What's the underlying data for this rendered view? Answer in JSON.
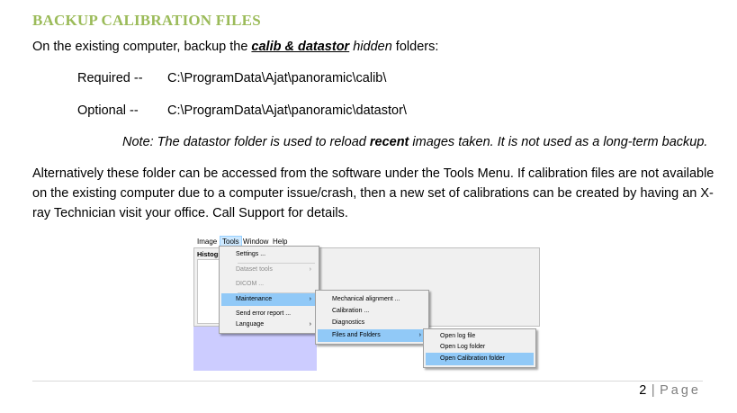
{
  "heading": "BACKUP CALIBRATION FILES",
  "intro": {
    "before": "On the existing computer, backup the ",
    "emph": "calib & datastor",
    "middle": " hidden",
    "after": " folders:"
  },
  "required": {
    "label": "Required --",
    "path": "C:\\ProgramData\\Ajat\\panoramic\\calib\\"
  },
  "optional": {
    "label": "Optional --",
    "path": "C:\\ProgramData\\Ajat\\panoramic\\datastor\\"
  },
  "note": {
    "before": "Note:  The datastor folder is used to reload ",
    "bold": "recent",
    "after": " images taken.  It is not used as a long-term backup."
  },
  "paragraph": [
    "Alternatively these folder can be accessed from the software under the Tools Menu.  If calibration files are not available",
    "on the existing computer due to a computer issue/crash, then a new set of calibrations can be created by having an X-",
    "ray Technician visit your office.  Call Support for details."
  ],
  "screenshot": {
    "menubar": [
      "Image",
      "Tools",
      "Window",
      "Help"
    ],
    "window_label": "Histogr",
    "tools_menu": [
      {
        "label": "Settings ...",
        "disabled": false,
        "submenu": false
      },
      {
        "label": "Dataset tools",
        "disabled": true,
        "submenu": true
      },
      {
        "label": "DICOM ...",
        "disabled": true,
        "submenu": false
      },
      {
        "label": "Maintenance",
        "disabled": false,
        "submenu": true,
        "highlighted": true
      },
      {
        "label": "Send error report ...",
        "disabled": false,
        "submenu": false
      },
      {
        "label": "Language",
        "disabled": false,
        "submenu": true
      }
    ],
    "maintenance_menu": [
      {
        "label": "Mechanical alignment ..."
      },
      {
        "label": "Calibration ..."
      },
      {
        "label": "Diagnostics"
      },
      {
        "label": "Files and Folders",
        "submenu": true,
        "highlighted": true
      }
    ],
    "files_menu": [
      {
        "label": "Open log file"
      },
      {
        "label": "Open Log folder"
      },
      {
        "label": "Open Calibration folder",
        "highlighted": true
      }
    ],
    "highlight_color": "#91c9f7"
  },
  "footer": {
    "page_num": "2",
    "sep": "|",
    "page_word": "Page"
  },
  "colors": {
    "heading": "#9bbb59"
  }
}
